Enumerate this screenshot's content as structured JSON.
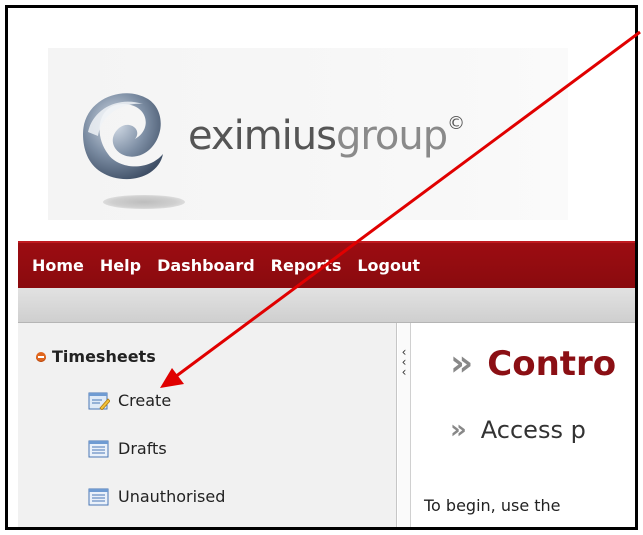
{
  "brand": {
    "name_dark": "eximius",
    "name_light": "group",
    "mark": "©"
  },
  "nav": {
    "items": [
      "Home",
      "Help",
      "Dashboard",
      "Reports",
      "Logout"
    ]
  },
  "sidebar": {
    "section_title": "Timesheets",
    "items": [
      {
        "label": "Create",
        "icon": "edit-document-icon"
      },
      {
        "label": "Drafts",
        "icon": "list-document-icon"
      },
      {
        "label": "Unauthorised",
        "icon": "list-document-icon"
      }
    ],
    "collapse_glyph": "<<<"
  },
  "main": {
    "title": "Contro",
    "subtitle": "Access p",
    "body": "To begin, use the"
  },
  "colors": {
    "nav_bg": "#8a0a0e",
    "title_red": "#8b0f14",
    "annotation_arrow": "#e00000",
    "bullet": "#e0661e"
  }
}
